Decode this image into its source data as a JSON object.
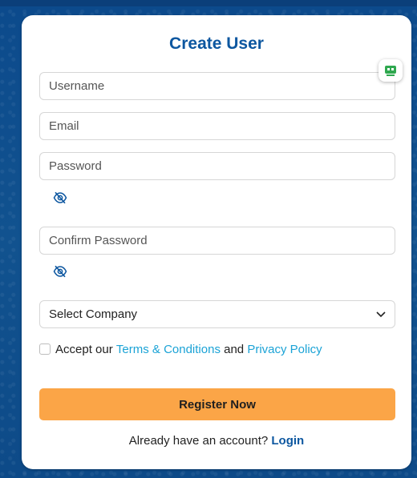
{
  "form": {
    "title": "Create User",
    "username_placeholder": "Username",
    "email_placeholder": "Email",
    "password_placeholder": "Password",
    "confirm_password_placeholder": "Confirm Password",
    "company_select_value": "Select Company",
    "terms_prefix": "Accept our",
    "terms_link": "Terms & Conditions",
    "terms_and": "and",
    "privacy_link": "Privacy Policy",
    "register_label": "Register Now",
    "footer_prefix": "Already have an account?",
    "login_link": "Login"
  },
  "icons": {
    "password_toggle": "eye-slash-icon",
    "confirm_toggle": "eye-slash-icon",
    "select_caret": "chevron-down-icon",
    "extension_badge": "robot-icon"
  },
  "colors": {
    "title": "#0d57a0",
    "link": "#1ba3d6",
    "button": "#fba547",
    "background": "#0f4c8a"
  }
}
